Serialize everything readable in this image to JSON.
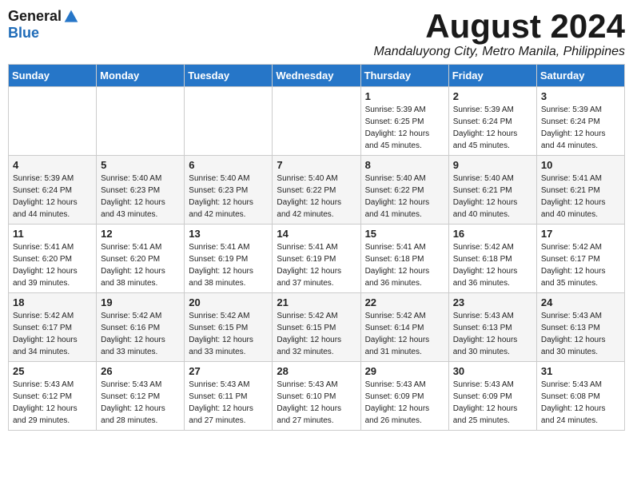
{
  "logo": {
    "general": "General",
    "blue": "Blue"
  },
  "title": "August 2024",
  "location": "Mandaluyong City, Metro Manila, Philippines",
  "days_header": [
    "Sunday",
    "Monday",
    "Tuesday",
    "Wednesday",
    "Thursday",
    "Friday",
    "Saturday"
  ],
  "weeks": [
    [
      {
        "day": "",
        "sunrise": "",
        "sunset": "",
        "daylight": ""
      },
      {
        "day": "",
        "sunrise": "",
        "sunset": "",
        "daylight": ""
      },
      {
        "day": "",
        "sunrise": "",
        "sunset": "",
        "daylight": ""
      },
      {
        "day": "",
        "sunrise": "",
        "sunset": "",
        "daylight": ""
      },
      {
        "day": "1",
        "sunrise": "Sunrise: 5:39 AM",
        "sunset": "Sunset: 6:25 PM",
        "daylight": "Daylight: 12 hours and 45 minutes."
      },
      {
        "day": "2",
        "sunrise": "Sunrise: 5:39 AM",
        "sunset": "Sunset: 6:24 PM",
        "daylight": "Daylight: 12 hours and 45 minutes."
      },
      {
        "day": "3",
        "sunrise": "Sunrise: 5:39 AM",
        "sunset": "Sunset: 6:24 PM",
        "daylight": "Daylight: 12 hours and 44 minutes."
      }
    ],
    [
      {
        "day": "4",
        "sunrise": "Sunrise: 5:39 AM",
        "sunset": "Sunset: 6:24 PM",
        "daylight": "Daylight: 12 hours and 44 minutes."
      },
      {
        "day": "5",
        "sunrise": "Sunrise: 5:40 AM",
        "sunset": "Sunset: 6:23 PM",
        "daylight": "Daylight: 12 hours and 43 minutes."
      },
      {
        "day": "6",
        "sunrise": "Sunrise: 5:40 AM",
        "sunset": "Sunset: 6:23 PM",
        "daylight": "Daylight: 12 hours and 42 minutes."
      },
      {
        "day": "7",
        "sunrise": "Sunrise: 5:40 AM",
        "sunset": "Sunset: 6:22 PM",
        "daylight": "Daylight: 12 hours and 42 minutes."
      },
      {
        "day": "8",
        "sunrise": "Sunrise: 5:40 AM",
        "sunset": "Sunset: 6:22 PM",
        "daylight": "Daylight: 12 hours and 41 minutes."
      },
      {
        "day": "9",
        "sunrise": "Sunrise: 5:40 AM",
        "sunset": "Sunset: 6:21 PM",
        "daylight": "Daylight: 12 hours and 40 minutes."
      },
      {
        "day": "10",
        "sunrise": "Sunrise: 5:41 AM",
        "sunset": "Sunset: 6:21 PM",
        "daylight": "Daylight: 12 hours and 40 minutes."
      }
    ],
    [
      {
        "day": "11",
        "sunrise": "Sunrise: 5:41 AM",
        "sunset": "Sunset: 6:20 PM",
        "daylight": "Daylight: 12 hours and 39 minutes."
      },
      {
        "day": "12",
        "sunrise": "Sunrise: 5:41 AM",
        "sunset": "Sunset: 6:20 PM",
        "daylight": "Daylight: 12 hours and 38 minutes."
      },
      {
        "day": "13",
        "sunrise": "Sunrise: 5:41 AM",
        "sunset": "Sunset: 6:19 PM",
        "daylight": "Daylight: 12 hours and 38 minutes."
      },
      {
        "day": "14",
        "sunrise": "Sunrise: 5:41 AM",
        "sunset": "Sunset: 6:19 PM",
        "daylight": "Daylight: 12 hours and 37 minutes."
      },
      {
        "day": "15",
        "sunrise": "Sunrise: 5:41 AM",
        "sunset": "Sunset: 6:18 PM",
        "daylight": "Daylight: 12 hours and 36 minutes."
      },
      {
        "day": "16",
        "sunrise": "Sunrise: 5:42 AM",
        "sunset": "Sunset: 6:18 PM",
        "daylight": "Daylight: 12 hours and 36 minutes."
      },
      {
        "day": "17",
        "sunrise": "Sunrise: 5:42 AM",
        "sunset": "Sunset: 6:17 PM",
        "daylight": "Daylight: 12 hours and 35 minutes."
      }
    ],
    [
      {
        "day": "18",
        "sunrise": "Sunrise: 5:42 AM",
        "sunset": "Sunset: 6:17 PM",
        "daylight": "Daylight: 12 hours and 34 minutes."
      },
      {
        "day": "19",
        "sunrise": "Sunrise: 5:42 AM",
        "sunset": "Sunset: 6:16 PM",
        "daylight": "Daylight: 12 hours and 33 minutes."
      },
      {
        "day": "20",
        "sunrise": "Sunrise: 5:42 AM",
        "sunset": "Sunset: 6:15 PM",
        "daylight": "Daylight: 12 hours and 33 minutes."
      },
      {
        "day": "21",
        "sunrise": "Sunrise: 5:42 AM",
        "sunset": "Sunset: 6:15 PM",
        "daylight": "Daylight: 12 hours and 32 minutes."
      },
      {
        "day": "22",
        "sunrise": "Sunrise: 5:42 AM",
        "sunset": "Sunset: 6:14 PM",
        "daylight": "Daylight: 12 hours and 31 minutes."
      },
      {
        "day": "23",
        "sunrise": "Sunrise: 5:43 AM",
        "sunset": "Sunset: 6:13 PM",
        "daylight": "Daylight: 12 hours and 30 minutes."
      },
      {
        "day": "24",
        "sunrise": "Sunrise: 5:43 AM",
        "sunset": "Sunset: 6:13 PM",
        "daylight": "Daylight: 12 hours and 30 minutes."
      }
    ],
    [
      {
        "day": "25",
        "sunrise": "Sunrise: 5:43 AM",
        "sunset": "Sunset: 6:12 PM",
        "daylight": "Daylight: 12 hours and 29 minutes."
      },
      {
        "day": "26",
        "sunrise": "Sunrise: 5:43 AM",
        "sunset": "Sunset: 6:12 PM",
        "daylight": "Daylight: 12 hours and 28 minutes."
      },
      {
        "day": "27",
        "sunrise": "Sunrise: 5:43 AM",
        "sunset": "Sunset: 6:11 PM",
        "daylight": "Daylight: 12 hours and 27 minutes."
      },
      {
        "day": "28",
        "sunrise": "Sunrise: 5:43 AM",
        "sunset": "Sunset: 6:10 PM",
        "daylight": "Daylight: 12 hours and 27 minutes."
      },
      {
        "day": "29",
        "sunrise": "Sunrise: 5:43 AM",
        "sunset": "Sunset: 6:09 PM",
        "daylight": "Daylight: 12 hours and 26 minutes."
      },
      {
        "day": "30",
        "sunrise": "Sunrise: 5:43 AM",
        "sunset": "Sunset: 6:09 PM",
        "daylight": "Daylight: 12 hours and 25 minutes."
      },
      {
        "day": "31",
        "sunrise": "Sunrise: 5:43 AM",
        "sunset": "Sunset: 6:08 PM",
        "daylight": "Daylight: 12 hours and 24 minutes."
      }
    ]
  ]
}
